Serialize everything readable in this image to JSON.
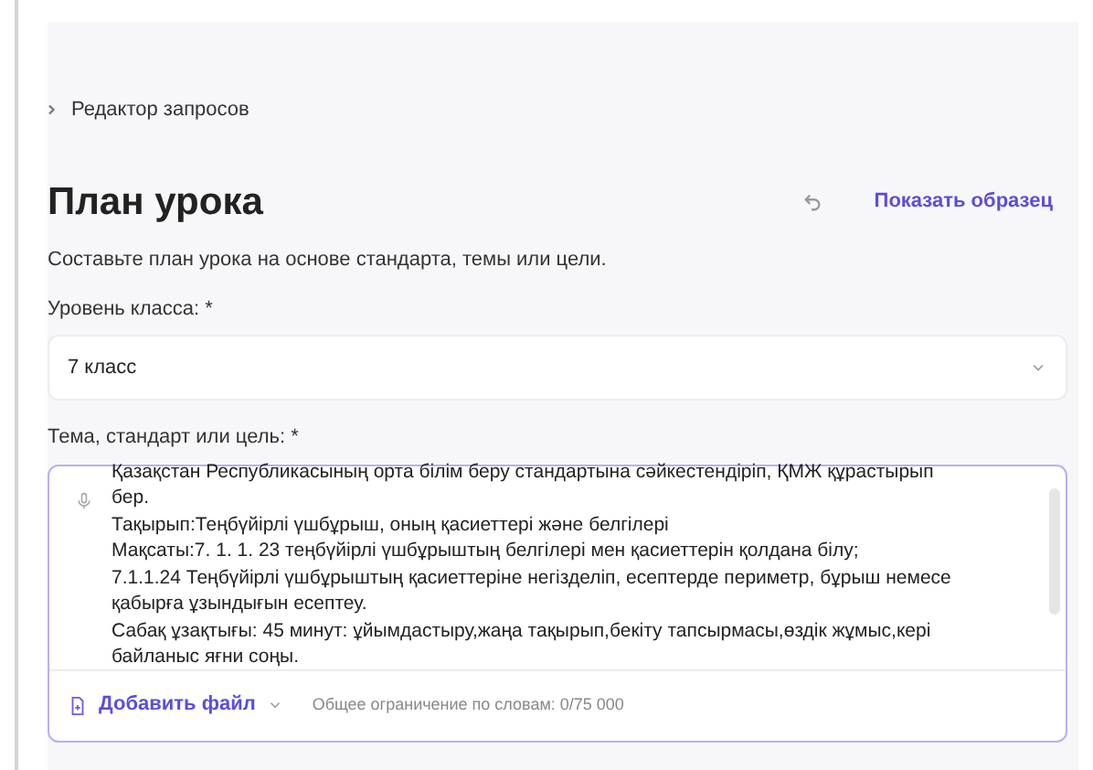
{
  "breadcrumb": "Редактор запросов",
  "title": "План урока",
  "show_example": "Показать образец",
  "subtitle": "Составьте план урока на основе стандарта, темы или цели.",
  "grade": {
    "label": "Уровень класса:",
    "required": "*",
    "value": "7 класс"
  },
  "topic": {
    "label": "Тема, стандарт или цель:",
    "required": "*",
    "value": "Қазақстан Республикасының орта білім беру стандартына сәйкестендіріп, ҚМЖ құрастырып бер.\nТақырып:Теңбүйірлі үшбұрыш, оның қасиеттері және белгілері\nМақсаты:7. 1. 1. 23 теңбүйірлі үшбұрыштың белгілері мен қасиеттерін қолдана білу;\n7.1.1.24 Теңбүйірлі үшбұрыштың қасиеттеріне негізделіп, есептерде периметр, бұрыш немесе қабырға ұзындығын есептеу.\nСабақ ұзақтығы: 45 минут: ұйымдастыру,жаңа тақырып,бекіту тапсырмасы,өздік жұмыс,кері байланыс яғни соңы."
  },
  "add_file": "Добавить файл",
  "word_limit": "Общее ограничение по словам: 0/75 000"
}
